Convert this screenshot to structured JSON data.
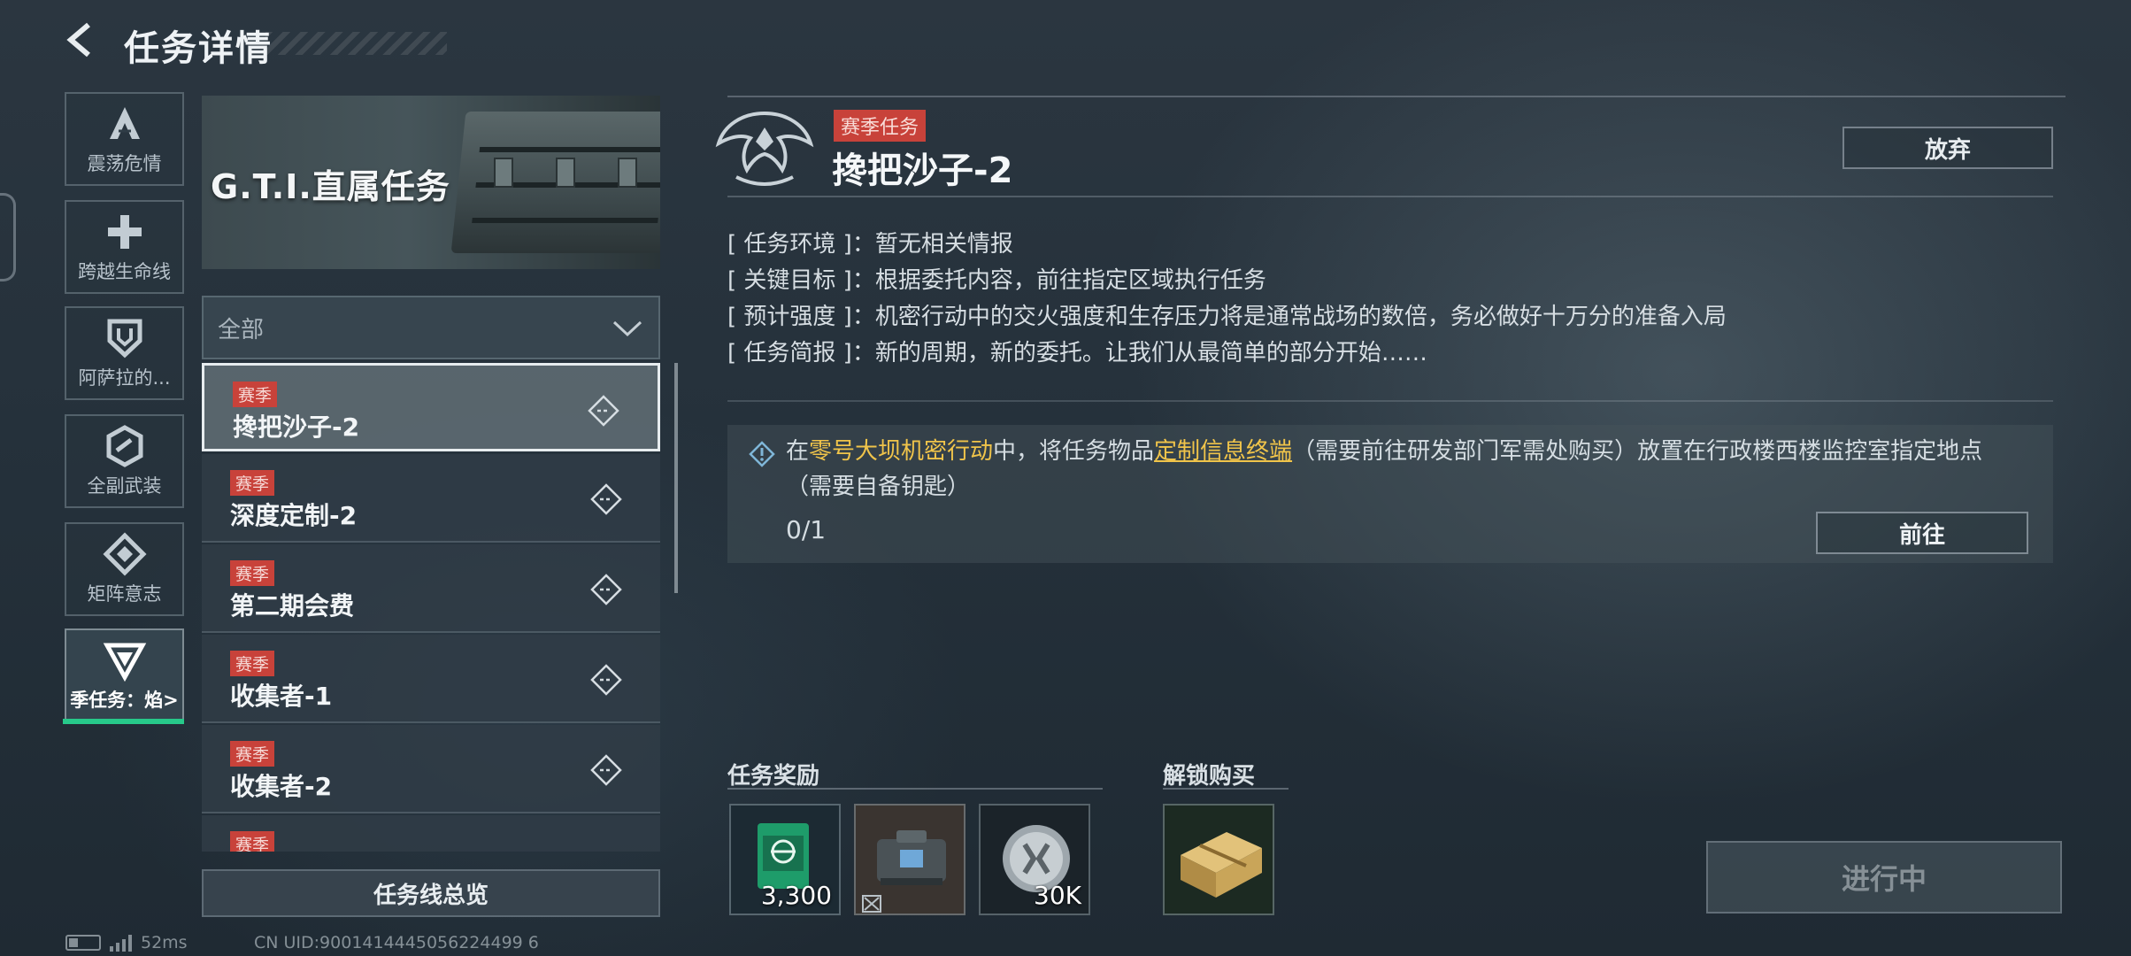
{
  "header": {
    "title": "任务详情"
  },
  "categories": [
    {
      "label": "震荡危情",
      "icon": "triangle-a-icon"
    },
    {
      "label": "跨越生命线",
      "icon": "cross-icon"
    },
    {
      "label": "阿萨拉的...",
      "icon": "shield-icon"
    },
    {
      "label": "全副武装",
      "icon": "hexagon-icon"
    },
    {
      "label": "矩阵意志",
      "icon": "diamond-icon"
    },
    {
      "label": "季任务：焰>",
      "icon": "chevron-triangle-icon",
      "active": true
    }
  ],
  "banner": {
    "title": "G.T.I.直属任务"
  },
  "filter": {
    "value": "全部"
  },
  "missions": [
    {
      "badge": "赛季",
      "name": "搀把沙子-2",
      "selected": true
    },
    {
      "badge": "赛季",
      "name": "深度定制-2"
    },
    {
      "badge": "赛季",
      "name": "第二期会费"
    },
    {
      "badge": "赛季",
      "name": "收集者-1"
    },
    {
      "badge": "赛季",
      "name": "收集者-2"
    },
    {
      "badge": "赛季",
      "name": ""
    }
  ],
  "overview_button": "任务线总览",
  "status": {
    "ping": "52ms",
    "uid": "CN UID:9001414445056224499 6"
  },
  "detail": {
    "season_badge": "赛季任务",
    "title": "搀把沙子-2",
    "abandon_label": "放弃",
    "info": [
      {
        "key": "[ 任务环境 ]",
        "value": "暂无相关情报"
      },
      {
        "key": "[ 关键目标 ]",
        "value": "根据委托内容，前往指定区域执行任务"
      },
      {
        "key": "[ 预计强度 ]",
        "value": "机密行动中的交火强度和生存压力将是通常战场的数倍，务必做好十万分的准备入局"
      },
      {
        "key": "[ 任务简报 ]",
        "value": "新的周期，新的委托。让我们从最简单的部分开始……"
      }
    ],
    "objective": {
      "part1": "在",
      "location": "零号大坝机密行动",
      "part2": "中，将任务物品",
      "item": "定制信息终端",
      "part3": "（需要前往研发部门军需处购买）放置在行政楼西楼监控室指定地点（需要自备钥匙）",
      "progress": "0/1",
      "go_label": "前往"
    }
  },
  "rewards": {
    "title": "任务奖励",
    "items": [
      {
        "icon": "green-card-icon",
        "qty": "3,300"
      },
      {
        "icon": "backpack-icon",
        "qty": ""
      },
      {
        "icon": "silver-coin-icon",
        "qty": "30K"
      }
    ]
  },
  "unlock": {
    "title": "解锁购买",
    "items": [
      {
        "icon": "gold-crate-icon"
      }
    ]
  },
  "in_progress_label": "进行中",
  "colors": {
    "season_red": "#c8423a",
    "highlight_yellow": "#f0c44a",
    "active_green": "#27c98a"
  }
}
